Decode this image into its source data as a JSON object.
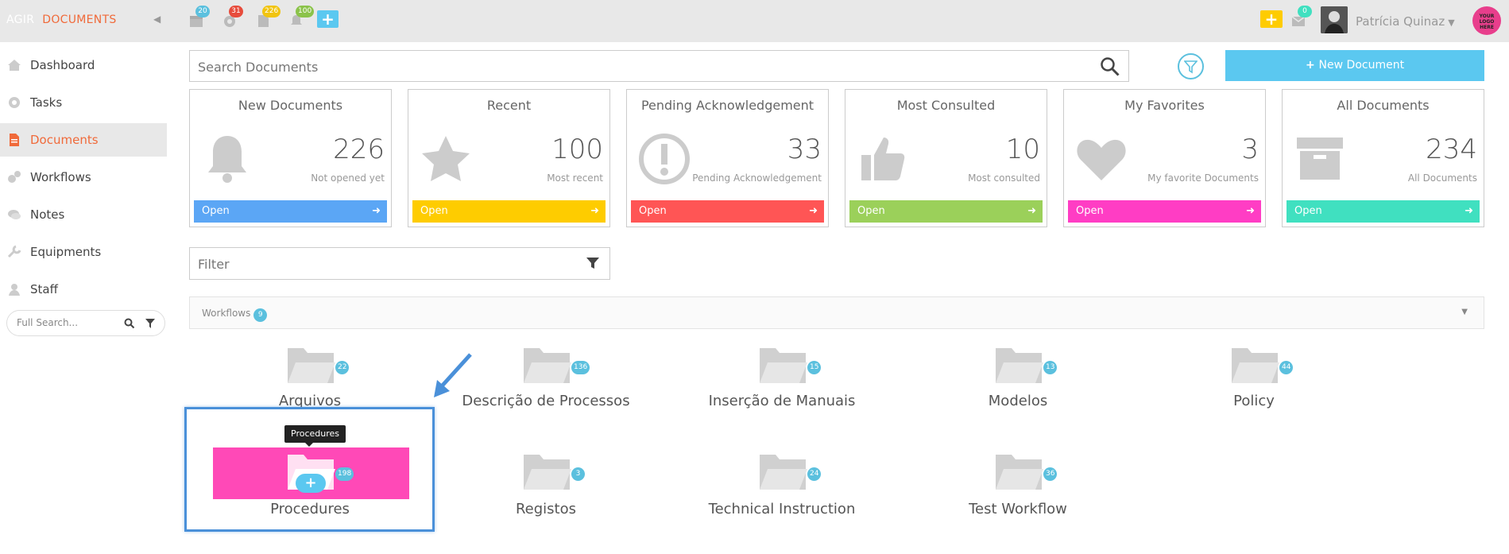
{
  "brand": {
    "app": "AGIR",
    "section": "DOCUMENTS"
  },
  "colors": {
    "accent": "#f06a3a",
    "blue": "#5bc0de",
    "pink": "#ff49b7"
  },
  "topbar": {
    "badges": [
      {
        "icon": "calendar-icon",
        "count": "20",
        "color": "#5bc0de"
      },
      {
        "icon": "gear-icon",
        "count": "31",
        "color": "#e74c3c"
      },
      {
        "icon": "document-icon",
        "count": "226",
        "color": "#f1c40f"
      },
      {
        "icon": "bell-icon",
        "count": "100",
        "color": "#8bc34a"
      }
    ],
    "mail_count": "0",
    "user_name": "Patrícia Quinaz",
    "logo_text": "YOUR LOGO HERE"
  },
  "sidebar": {
    "items": [
      {
        "label": "Dashboard",
        "icon": "home-icon"
      },
      {
        "label": "Tasks",
        "icon": "gear-icon"
      },
      {
        "label": "Documents",
        "icon": "document-icon",
        "active": true
      },
      {
        "label": "Workflows",
        "icon": "gears-icon"
      },
      {
        "label": "Notes",
        "icon": "comments-icon"
      },
      {
        "label": "Equipments",
        "icon": "wrench-icon"
      },
      {
        "label": "Staff",
        "icon": "user-icon"
      }
    ],
    "full_search_placeholder": "Full Search..."
  },
  "search": {
    "placeholder": "Search Documents"
  },
  "new_document_label": "New Document",
  "cards": [
    {
      "title": "New Documents",
      "value": "226",
      "sub": "Not opened yet",
      "open": "Open",
      "color": "#5ba6f5",
      "icon": "bell-icon"
    },
    {
      "title": "Recent",
      "value": "100",
      "sub": "Most recent",
      "open": "Open",
      "color": "#fecc00",
      "icon": "star-icon"
    },
    {
      "title": "Pending Acknowledgement",
      "value": "33",
      "sub": "Pending Acknowledgement",
      "open": "Open",
      "color": "#ff5555",
      "icon": "exclamation-icon"
    },
    {
      "title": "Most Consulted",
      "value": "10",
      "sub": "Most consulted",
      "open": "Open",
      "color": "#9bd05a",
      "icon": "thumbs-up-icon"
    },
    {
      "title": "My Favorites",
      "value": "3",
      "sub": "My favorite Documents",
      "open": "Open",
      "color": "#ff3dc4",
      "icon": "heart-icon"
    },
    {
      "title": "All Documents",
      "value": "234",
      "sub": "All Documents",
      "open": "Open",
      "color": "#40e0c0",
      "icon": "archive-icon"
    }
  ],
  "filter": {
    "placeholder": "Filter"
  },
  "workflows": {
    "label": "Workflows",
    "count": "9",
    "folders": [
      {
        "name": "Arquivos",
        "count": "22"
      },
      {
        "name": "Descrição de Processos",
        "count": "136"
      },
      {
        "name": "Inserção de Manuais",
        "count": "15"
      },
      {
        "name": "Modelos",
        "count": "13"
      },
      {
        "name": "Policy",
        "count": "44"
      },
      {
        "name": "Procedures",
        "count": "198",
        "highlighted": true,
        "tooltip": "Procedures"
      },
      {
        "name": "Registos",
        "count": "3"
      },
      {
        "name": "Technical Instruction",
        "count": "24"
      },
      {
        "name": "Test Workflow",
        "count": "36"
      }
    ]
  }
}
